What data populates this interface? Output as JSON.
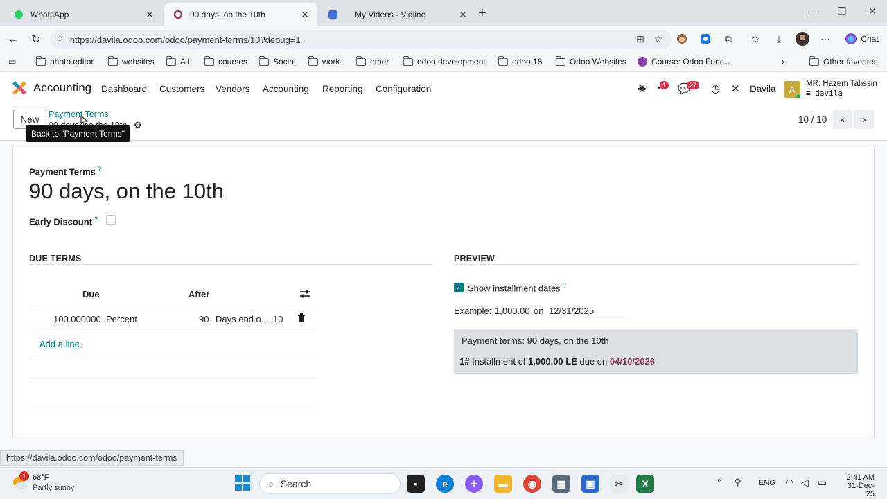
{
  "browser": {
    "tabs": [
      {
        "title": "WhatsApp",
        "active": false
      },
      {
        "title": "90 days, on the 10th",
        "active": true
      },
      {
        "title": "My Videos - Vidline",
        "active": false
      }
    ],
    "url": "https://davila.odoo.com/odoo/payment-terms/10?debug=1",
    "chat_label": "Chat",
    "bookmarks": [
      "photo editor",
      "websites",
      "A I",
      "courses",
      "Social",
      "work",
      "other",
      "odoo development",
      "odoo 18",
      "Odoo Websites",
      "Course: Odoo Func..."
    ],
    "other_favorites": "Other favorites"
  },
  "odoo": {
    "app_name": "Accounting",
    "menu": [
      "Dashboard",
      "Customers",
      "Vendors",
      "Accounting",
      "Reporting",
      "Configuration"
    ],
    "activity_badge": "1",
    "messages_badge": "27",
    "company": "Davila",
    "avatar_letter": "A",
    "user_name": "MR. Hazem Tahssin",
    "user_db": "davila"
  },
  "control": {
    "new_label": "New",
    "breadcrumb_parent": "Payment Terms",
    "breadcrumb_current": "90 days, on the 10th",
    "tooltip": "Back to \"Payment Terms\"",
    "pager": "10 / 10"
  },
  "form": {
    "name_label": "Payment Terms",
    "name_value": "90 days, on the 10th",
    "early_discount_label": "Early Discount",
    "help_mark": "?",
    "due_terms_title": "DUE TERMS",
    "col_due": "Due",
    "col_after": "After",
    "row": {
      "value": "100.000000",
      "type": "Percent",
      "days": "90",
      "delay_type": "Days end o...",
      "day_of_month": "10"
    },
    "add_line": "Add a line",
    "preview_title": "PREVIEW",
    "show_installment_label": "Show installment dates",
    "example_label": "Example:",
    "example_amount": "1,000.00",
    "example_on": "on",
    "example_date": "12/31/2025",
    "preview_terms": "Payment terms: 90 days, on the 10th",
    "installment_num": "1#",
    "installment_text": "Installment of",
    "installment_amount": "1,000.00 LE",
    "installment_due": "due on",
    "installment_date": "04/10/2026"
  },
  "status_url": "https://davila.odoo.com/odoo/payment-terms",
  "taskbar": {
    "temperature": "68°F",
    "weather": "Partly sunny",
    "weather_badge": "1",
    "search_placeholder": "Search",
    "lang": "ENG",
    "time": "2:41 AM",
    "date": "31-Dec-25"
  }
}
